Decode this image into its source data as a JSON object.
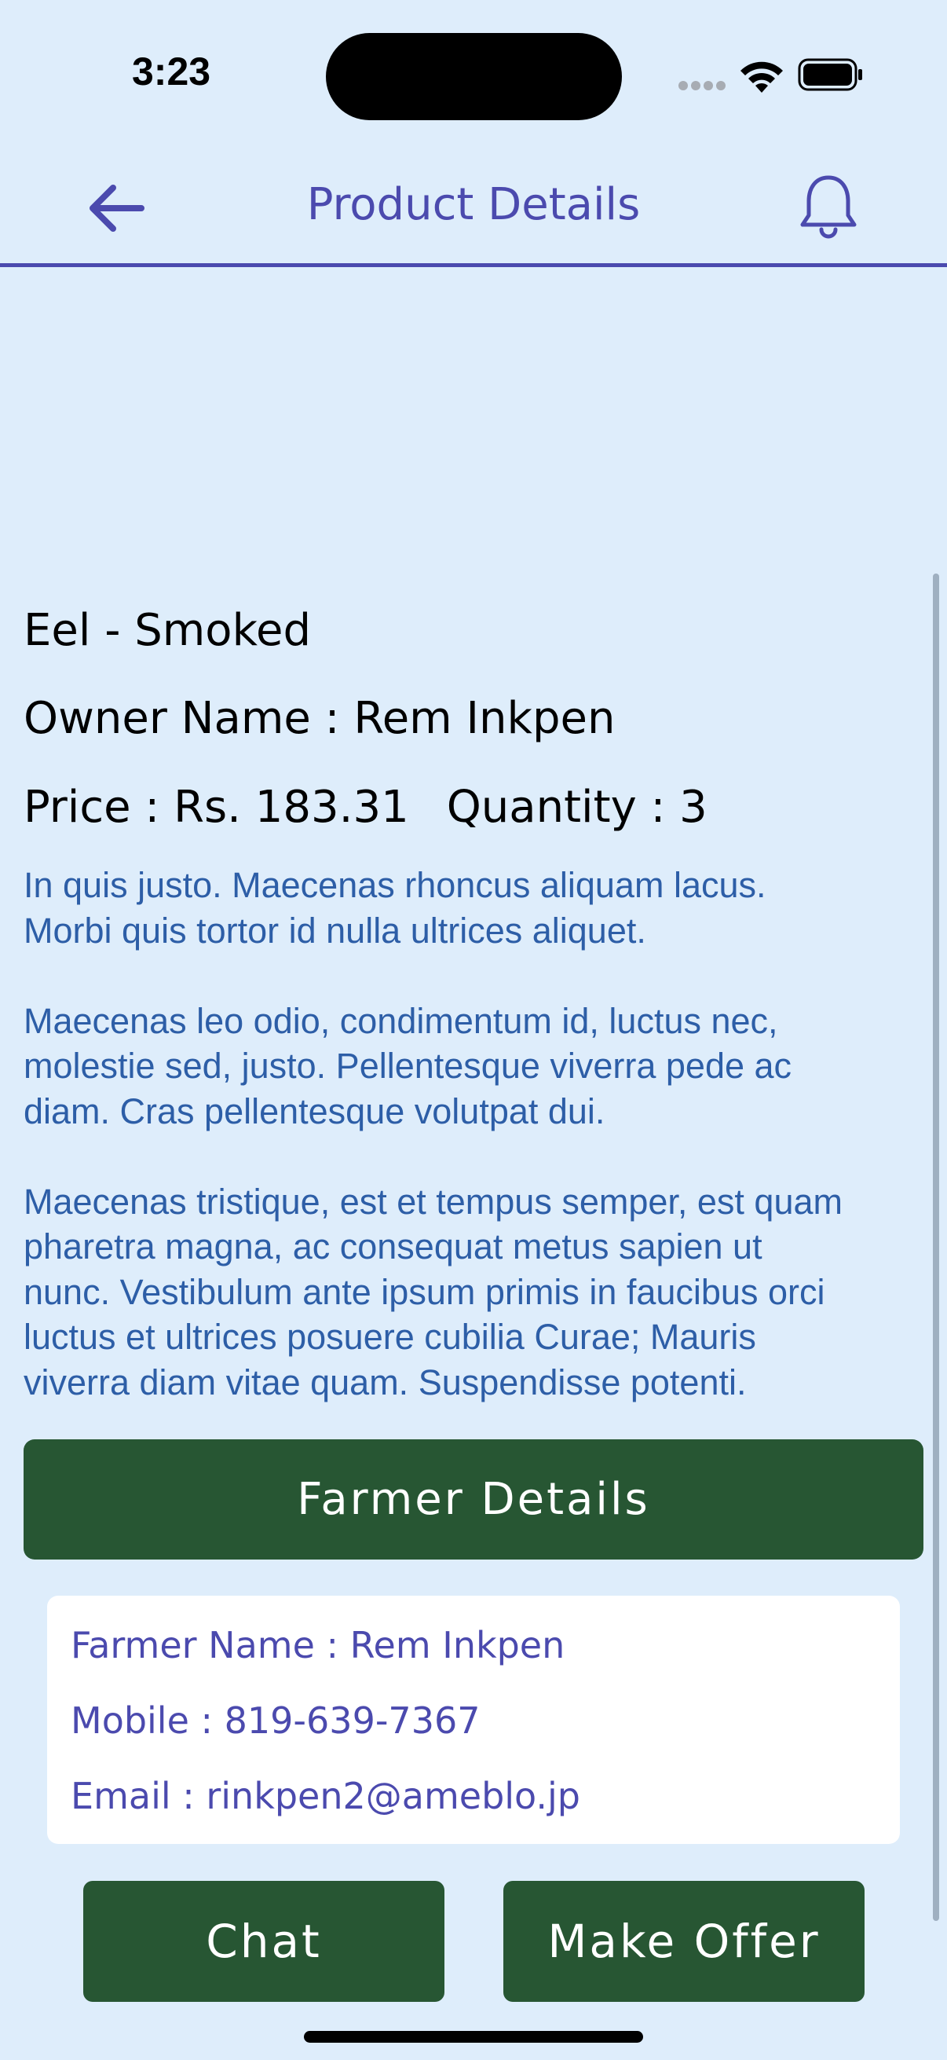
{
  "status_bar": {
    "time": "3:23"
  },
  "header": {
    "title": "Product Details"
  },
  "product": {
    "name": "Eel - Smoked",
    "owner": "Owner Name : Rem Inkpen",
    "price": "Price : Rs. 183.31",
    "quantity": "Quantity : 3",
    "description": "In quis justo. Maecenas rhoncus aliquam lacus.\nMorbi quis tortor id nulla ultrices aliquet.\n\nMaecenas leo odio, condimentum id, luctus nec,\nmolestie sed, justo. Pellentesque viverra pede ac\ndiam. Cras pellentesque volutpat dui.\n\nMaecenas tristique, est et tempus semper, est quam\npharetra magna, ac consequat metus sapien ut\nnunc. Vestibulum ante ipsum primis in faucibus orci\nluctus et ultrices posuere cubilia Curae; Mauris\nviverra diam vitae quam. Suspendisse potenti."
  },
  "farmer": {
    "section_label": "Farmer Details",
    "name": "Farmer Name : Rem Inkpen",
    "mobile": "Mobile : 819-639-7367",
    "email": "Email : rinkpen2@ameblo.jp"
  },
  "actions": {
    "chat_label": "Chat",
    "offer_label": "Make Offer"
  },
  "icons": {
    "back": "arrow-left-icon",
    "notifications": "bell-icon",
    "wifi": "wifi-icon",
    "battery": "battery-icon",
    "signal": "cellular-signal-icon"
  },
  "colors": {
    "background": "#deedfb",
    "accent": "#4b4aae",
    "button": "#275633",
    "description_text": "#2d5ea7",
    "card": "#ffffff"
  }
}
